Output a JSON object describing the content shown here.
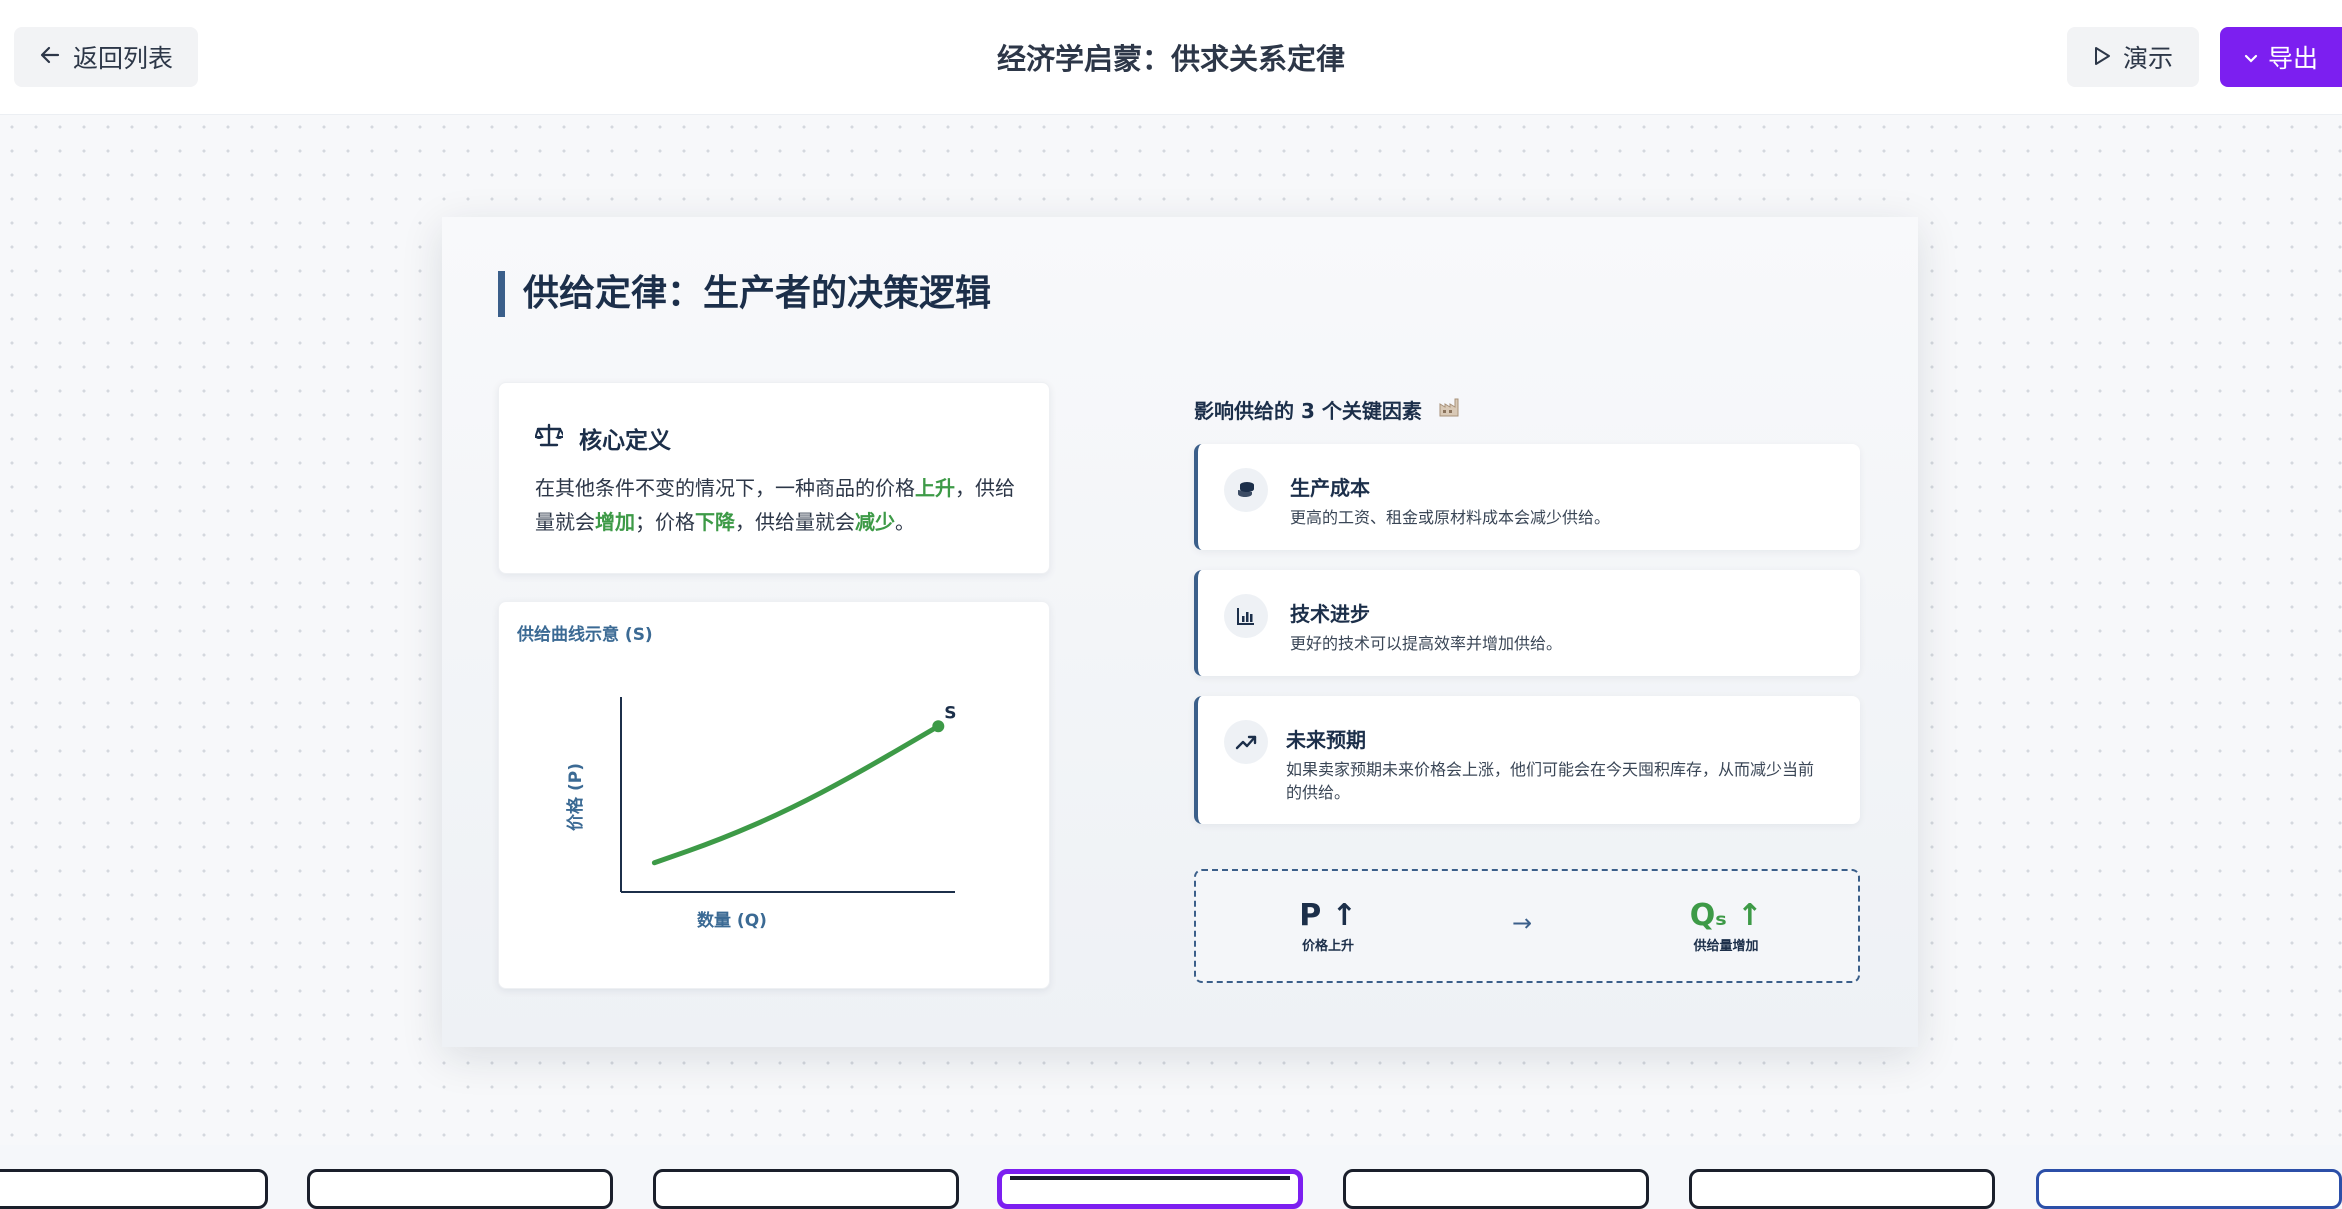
{
  "header": {
    "back_label": "返回列表",
    "title": "经济学启蒙：供求关系定律",
    "present_label": "演示",
    "export_label": "导出"
  },
  "slide": {
    "title": "供给定律：生产者的决策逻辑",
    "definition": {
      "heading": "核心定义",
      "parts": [
        "在其他条件不变的情况下，一种商品的价格",
        "上升",
        "，供给量就会",
        "增加",
        "；价格",
        "下降",
        "，供给量就会",
        "减少",
        "。"
      ]
    },
    "factors_title": "影响供给的 3 个关键因素",
    "factors": [
      {
        "name": "生产成本",
        "desc": "更高的工资、租金或原材料成本会减少供给。",
        "icon": "coins-icon"
      },
      {
        "name": "技术进步",
        "desc": "更好的技术可以提高效率并增加供给。",
        "icon": "bar-chart-icon"
      },
      {
        "name": "未来预期",
        "desc": "如果卖家预期未来价格会上涨，他们可能会在今天囤积库存，从而减少当前的供给。",
        "icon": "trend-up-icon"
      }
    ],
    "summary": {
      "left_symbol": "P ↑",
      "left_label": "价格上升",
      "arrow": "→",
      "right_symbol": "Qₛ ↑",
      "right_label": "供给量增加"
    }
  },
  "chart_data": {
    "type": "line",
    "title": "供给曲线示意 (S)",
    "xlabel": "数量 (Q)",
    "ylabel": "价格 (P)",
    "series": [
      {
        "name": "S",
        "x": [
          0.1,
          0.3,
          0.5,
          0.7,
          0.95
        ],
        "y": [
          0.15,
          0.27,
          0.42,
          0.6,
          0.85
        ]
      }
    ],
    "xlim": [
      0,
      1
    ],
    "ylim": [
      0,
      1
    ],
    "grid": false
  },
  "colors": {
    "accent": "#7c1ff0",
    "title_navy": "#1c2f4a",
    "curve_green": "#3d9a47",
    "bar_blue": "#3b5f8a"
  }
}
